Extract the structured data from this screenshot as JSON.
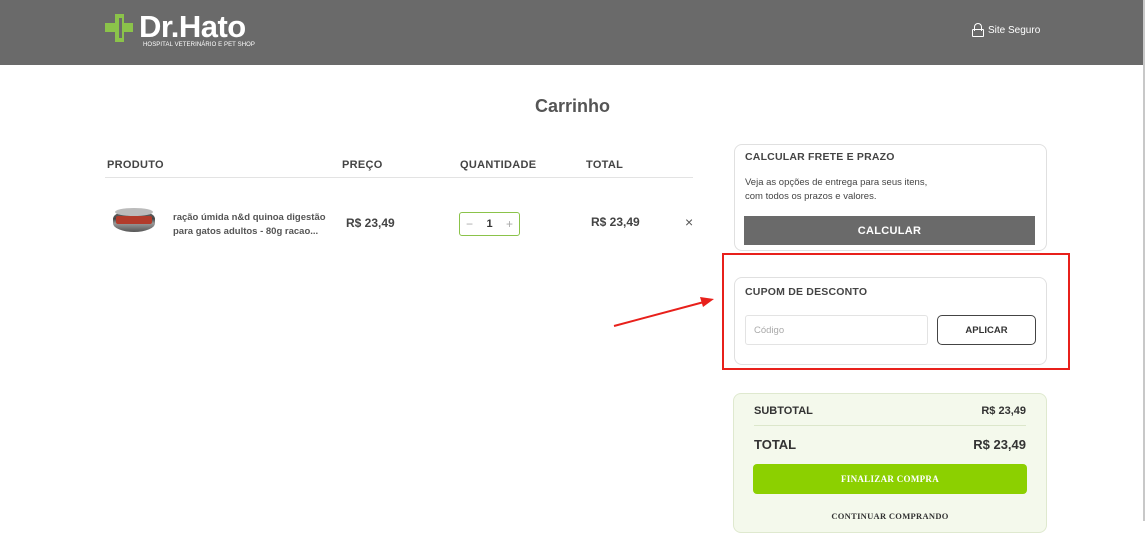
{
  "header": {
    "logo_name": "Dr.Hato",
    "logo_subtitle": "HOSPITAL VETERINÁRIO E PET SHOP",
    "secure_label": "Site Seguro"
  },
  "page": {
    "title": "Carrinho"
  },
  "cart": {
    "columns": {
      "product": "PRODUTO",
      "price": "PREÇO",
      "quantity": "QUANTIDADE",
      "total": "TOTAL"
    },
    "items": [
      {
        "name": "ração úmida n&d quinoa digestão para gatos adultos - 80g racao...",
        "price": "R$ 23,49",
        "quantity": "1",
        "total": "R$ 23,49",
        "minus": "−",
        "plus": "+",
        "remove": "×"
      }
    ]
  },
  "shipping": {
    "title": "CALCULAR FRETE E PRAZO",
    "description_line1": "Veja as opções de entrega para seus itens,",
    "description_line2": "com todos os prazos e valores.",
    "button": "CALCULAR"
  },
  "coupon": {
    "title": "CUPOM DE DESCONTO",
    "placeholder": "Código",
    "button": "APLICAR"
  },
  "summary": {
    "subtotal_label": "SUBTOTAL",
    "subtotal_value": "R$ 23,49",
    "total_label": "TOTAL",
    "total_value": "R$ 23,49",
    "checkout_button": "FINALIZAR COMPRA",
    "continue_link": "CONTINUAR COMPRANDO"
  },
  "colors": {
    "header": "#6a6a6a",
    "brand_green": "#8bc34a",
    "checkout_green": "#8cd000",
    "highlight_red": "#e8201b"
  }
}
